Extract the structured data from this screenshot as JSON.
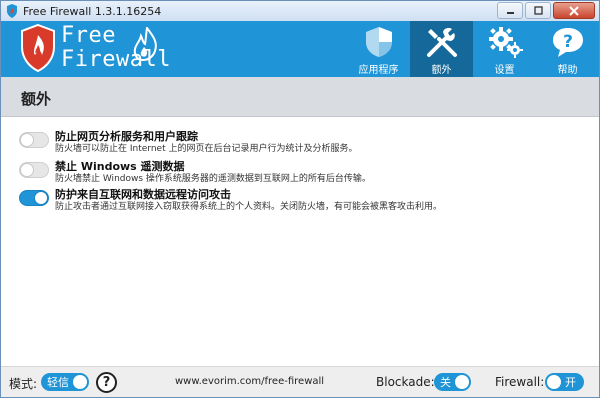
{
  "window": {
    "title": "Free Firewall 1.3.1.16254"
  },
  "colors": {
    "header_bg": "#1f94d6",
    "active_nav_bg": "#15689a",
    "toggle_on": "#1f94d6",
    "section_bar_bg": "#d9dce1"
  },
  "header": {
    "brand_line1": "Free",
    "brand_line2": "Firewall",
    "logo_icon": "flame-shield-icon",
    "nav": [
      {
        "label": "应用程序",
        "icon": "shield-icon",
        "active": false
      },
      {
        "label": "额外",
        "icon": "tools-icon",
        "active": true
      },
      {
        "label": "设置",
        "icon": "gears-icon",
        "active": false
      },
      {
        "label": "帮助",
        "icon": "question-bubble-icon",
        "active": false
      }
    ]
  },
  "section": {
    "title": "额外"
  },
  "options": [
    {
      "title": "防止网页分析服务和用户跟踪",
      "description": "防火墙可以防止在 Internet 上的网页在后台记录用户行为统计及分析服务。",
      "enabled": false
    },
    {
      "title": "禁止 Windows 遥测数据",
      "description": "防火墙禁止 Windows 操作系统服务器的遥测数据到互联网上的所有后台传输。",
      "enabled": false
    },
    {
      "title": "防护来自互联网和数据远程访问攻击",
      "description": "防止攻击者通过互联网接入窃取获得系统上的个人资料。关闭防火墙，有可能会被黑客攻击利用。",
      "enabled": true
    }
  ],
  "footer": {
    "mode_label": "模式:",
    "mode_value": "轻信",
    "help_symbol": "?",
    "website": "www.evorim.com/free-firewall",
    "blockade_label": "Blockade:",
    "blockade_value": "关",
    "firewall_label": "Firewall:",
    "firewall_value": "开"
  }
}
